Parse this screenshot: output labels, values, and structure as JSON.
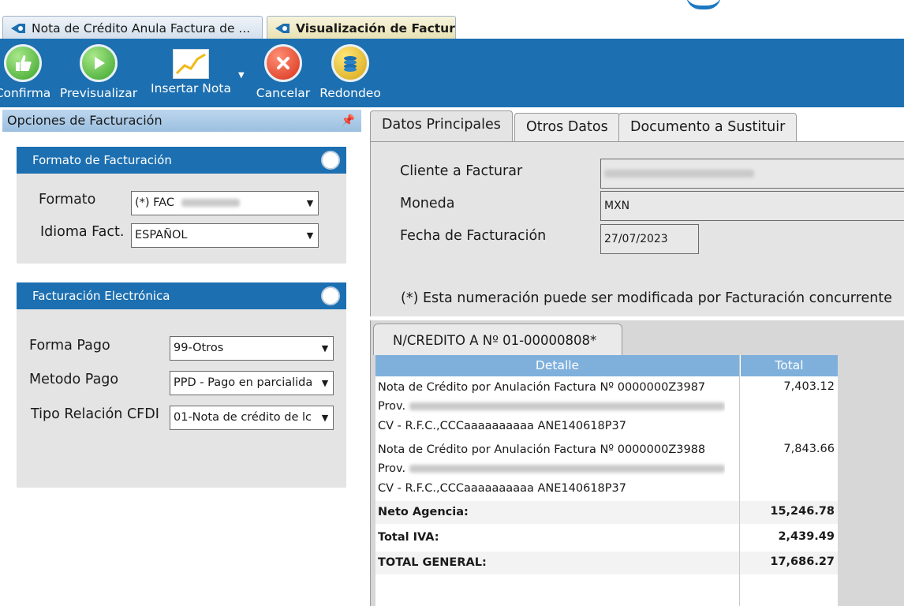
{
  "tabs": [
    {
      "label": "Nota de Crédito Anula Factura de ...",
      "active": false
    },
    {
      "label": "Visualización de Factura",
      "active": true
    }
  ],
  "toolbar": {
    "confirm_label": "Confirma",
    "preview_label": "Previsualizar",
    "insert_label": "Insertar Nota",
    "cancel_label": "Cancelar",
    "round_label": "Redondeo"
  },
  "left_panel": {
    "title": "Opciones de Facturación",
    "format_group": {
      "title": "Formato de Facturación",
      "format_label": "Formato",
      "format_value": "(*) FAC",
      "language_label": "Idioma Fact.",
      "language_value": "ESPAÑOL"
    },
    "electronic_group": {
      "title": "Facturación Electrónica",
      "payment_form_label": "Forma Pago",
      "payment_form_value": "99-Otros",
      "payment_method_label": "Metodo Pago",
      "payment_method_value": "PPD - Pago en parcialida",
      "relation_label": "Tipo Relación CFDI",
      "relation_value": "01-Nota de crédito de lc"
    }
  },
  "main": {
    "tabs": [
      {
        "label": "Datos Principales",
        "active": true
      },
      {
        "label": "Otros Datos",
        "active": false
      },
      {
        "label": "Documento a Sustituir",
        "active": false
      }
    ],
    "client_label": "Cliente a Facturar",
    "currency_label": "Moneda",
    "currency_value": "MXN",
    "date_label": "Fecha de Facturación",
    "date_value": "27/07/2023",
    "note": "(*) Esta numeración puede ser modificada por Facturación concurrente"
  },
  "detail": {
    "tab_label": "N/CREDITO A Nº 01-00000808*",
    "col_detail": "Detalle",
    "col_total": "Total",
    "rows": [
      {
        "line1": "Nota de Crédito por Anulación Factura Nº 0000000Z3987",
        "line2": "Prov.",
        "line3": "CV - R.F.C.,CCCaaaaaaaaaa ANE140618P37",
        "total": "7,403.12"
      },
      {
        "line1": "Nota de Crédito por Anulación Factura Nº 0000000Z3988",
        "line2": "Prov.",
        "line3": "CV - R.F.C.,CCCaaaaaaaaaa ANE140618P37",
        "total": "7,843.66"
      }
    ],
    "net_label": "Neto Agencia:",
    "net_value": "15,246.78",
    "iva_label": "Total IVA:",
    "iva_value": "2,439.49",
    "grand_label": "TOTAL GENERAL:",
    "grand_value": "17,686.27"
  },
  "colors": {
    "toolbar_bg": "#1c6fb0",
    "group_header_bg": "#1c6fb0",
    "grid_header_bg": "#7fb0dc",
    "panel_bg": "#e4e4e4"
  }
}
